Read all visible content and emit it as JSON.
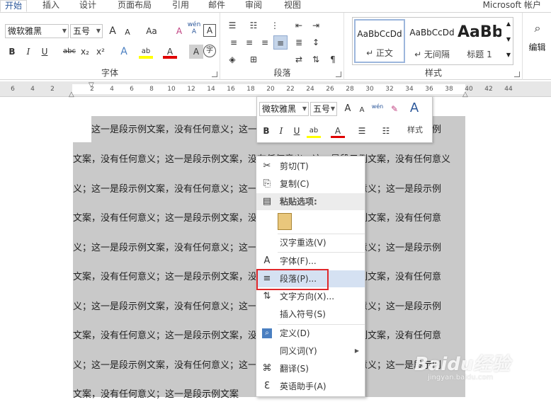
{
  "tabs": {
    "active": "开始",
    "items": [
      "插入",
      "设计",
      "页面布局",
      "引用",
      "邮件",
      "审阅",
      "视图"
    ],
    "account": "Microsoft 帐户"
  },
  "font_group": {
    "label": "字体",
    "font_name": "微软雅黑",
    "font_size": "五号",
    "grow": "A",
    "shrink": "A",
    "change_case": "Aa",
    "clear_format": "A",
    "phonetic": "wén",
    "phonetic_char": "A",
    "border_char": "A",
    "bold": "B",
    "italic": "I",
    "underline": "U",
    "strike": "abc",
    "subscript": "x₂",
    "superscript": "x²",
    "text_effect": "A",
    "highlight": "ab",
    "font_color": "A",
    "char_shading": "A",
    "enclose": "字"
  },
  "para_group": {
    "label": "段落"
  },
  "styles_group": {
    "label": "样式",
    "items": [
      {
        "sample": "AaBbCcDd",
        "name": "↵ 正文"
      },
      {
        "sample": "AaBbCcDd",
        "name": "↵ 无间隔"
      },
      {
        "sample": "AaBb",
        "name": "标题 1"
      }
    ]
  },
  "edit_group": {
    "label": "编辑"
  },
  "ruler": {
    "left_numbers": [
      "6",
      "4",
      "2"
    ],
    "right_numbers": [
      "2",
      "4",
      "6",
      "8",
      "10",
      "12",
      "14",
      "16",
      "18",
      "20",
      "22",
      "24",
      "26",
      "28",
      "30",
      "32",
      "34",
      "36",
      "38",
      "40",
      "42",
      "44"
    ]
  },
  "document": {
    "first_line": "这一是段示例文案，没有任何意义；这一是段示例文案，没有任何意义；这一是段示例",
    "lines": [
      "文案，没有任何意义；这一是段示例文案，没有任何意义；这一是段示例文案，没有任何意义",
      "义；这一是段示例文案，没有任何意义；这一是段示例文案，没有任何意义；这一是段示例",
      "文案，没有任何意义；这一是段示例文案，没有任何意义；这一是段示例文案，没有任何意",
      "义；这一是段示例文案，没有任何意义；这一是段示例文案，没有任何意义；这一是段示例",
      "文案，没有任何意义；这一是段示例文案，没有任何意义；这一是段示例文案，没有任何意",
      "义；这一是段示例文案，没有任何意义；这一是段示例文案，没有任何意义；这一是段示例",
      "文案，没有任何意义；这一是段示例文案，没有任何意义；这一是段示例文案，没有任何意",
      "义；这一是段示例文案，没有任何意义；这一是段示例文案，没有任何意义；这一是段示例",
      "文案，没有任何意义；这一是段示例文案"
    ]
  },
  "mini_toolbar": {
    "font_name": "微软雅黑",
    "font_size": "五号",
    "styles_label": "样式"
  },
  "context_menu": {
    "items": [
      {
        "icon": "scissors-icon",
        "glyph": "✂",
        "label": "剪切(T)"
      },
      {
        "icon": "copy-icon",
        "glyph": "⎘",
        "label": "复制(C)"
      },
      {
        "icon": "paste-icon",
        "glyph": "📋",
        "label": "粘贴选项:"
      },
      {
        "icon": "clipboard-icon",
        "glyph": "📋",
        "label": ""
      },
      {
        "icon": "none",
        "glyph": "",
        "label": "汉字重选(V)"
      },
      {
        "icon": "font-icon",
        "glyph": "A",
        "label": "字体(F)..."
      },
      {
        "icon": "paragraph-icon",
        "glyph": "≡",
        "label": "段落(P)..."
      },
      {
        "icon": "text-direction-icon",
        "glyph": "⇅",
        "label": "文字方向(X)..."
      },
      {
        "icon": "none",
        "glyph": "",
        "label": "插入符号(S)"
      },
      {
        "icon": "define-icon",
        "glyph": "🔍",
        "label": "定义(D)"
      },
      {
        "icon": "none",
        "glyph": "",
        "label": "同义词(Y)"
      },
      {
        "icon": "translate-icon",
        "glyph": "⌘",
        "label": "翻译(S)"
      },
      {
        "icon": "english-helper-icon",
        "glyph": "Ɛ",
        "label": "英语助手(A)"
      }
    ]
  },
  "watermark": {
    "main": "Baidu经验",
    "sub": "jingyan.baidu.com"
  },
  "colors": {
    "accent": "#2b579a",
    "highlight_box": "#e0282b",
    "selection": "#c9c9c9"
  }
}
